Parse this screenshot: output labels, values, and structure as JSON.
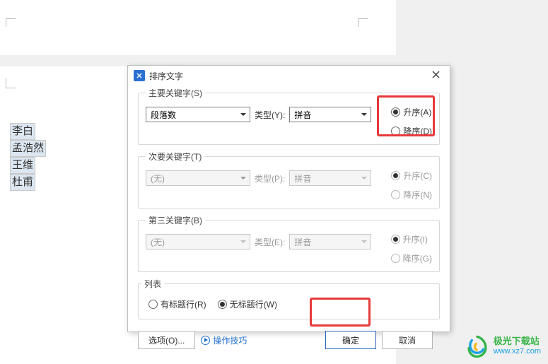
{
  "dialog": {
    "title": "排序文字",
    "primary": {
      "legend": "主要关键字(S)",
      "sort_field_value": "段落数",
      "type_label": "类型(Y):",
      "type_value": "拼音",
      "asc_label": "升序(A)",
      "desc_label": "降序(D)"
    },
    "secondary": {
      "legend": "次要关键字(T)",
      "sort_field_value": "(无)",
      "type_label": "类型(P):",
      "type_value": "拼音",
      "asc_label": "升序(C)",
      "desc_label": "降序(N)"
    },
    "third": {
      "legend": "第三关键字(B)",
      "sort_field_value": "(无)",
      "type_label": "类型(E):",
      "type_value": "拼音",
      "asc_label": "升序(I)",
      "desc_label": "降序(G)"
    },
    "list": {
      "legend": "列表",
      "header_label": "有标题行(R)",
      "noheader_label": "无标题行(W)"
    },
    "options_label": "选项(O)...",
    "tips_label": "操作技巧",
    "ok_label": "确定",
    "cancel_label": "取消"
  },
  "document_names": {
    "n1": "李白",
    "n2": "孟浩然",
    "n3": "王维",
    "n4": "杜甫"
  },
  "icons": {
    "app_logo": "app-logo",
    "close": "close-icon",
    "dropdown": "chevron-down-icon"
  },
  "watermark": {
    "cn": "极光下载站",
    "en": "www.xz7.com"
  }
}
